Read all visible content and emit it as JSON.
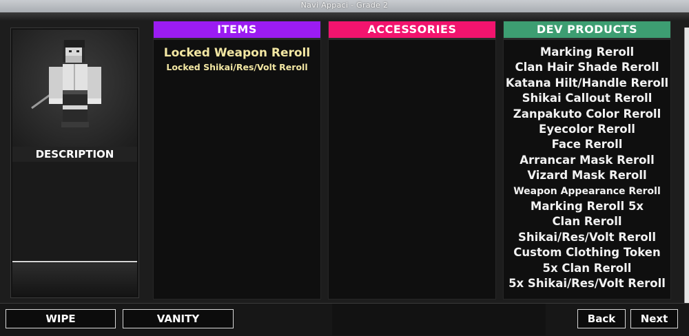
{
  "window": {
    "title": "Navi Appaci - Grade 2"
  },
  "profile": {
    "description_label": "DESCRIPTION"
  },
  "columns": {
    "items": {
      "header": "ITEMS",
      "color": "#9b1cf2",
      "entries": [
        "Locked Weapon Reroll",
        "Locked Shikai/Res/Volt Reroll"
      ]
    },
    "accessories": {
      "header": "ACCESSORIES",
      "color": "#f2146e",
      "entries": []
    },
    "dev_products": {
      "header": "DEV PRODUCTS",
      "color": "#3d9e72",
      "entries": [
        "Marking Reroll",
        "Clan Hair Shade Reroll",
        "Katana Hilt/Handle Reroll",
        "Shikai Callout Reroll",
        "Zanpakuto Color Reroll",
        "Eyecolor Reroll",
        "Face Reroll",
        "Arrancar Mask Reroll",
        "Vizard Mask Reroll",
        "Weapon Appearance Reroll",
        "Marking Reroll 5x",
        "Clan Reroll",
        "Shikai/Res/Volt Reroll",
        "Custom Clothing Token",
        "5x Clan Reroll",
        "5x Shikai/Res/Volt Reroll"
      ]
    }
  },
  "buttons": {
    "wipe": "WIPE",
    "vanity": "VANITY",
    "back": "Back",
    "next": "Next"
  }
}
